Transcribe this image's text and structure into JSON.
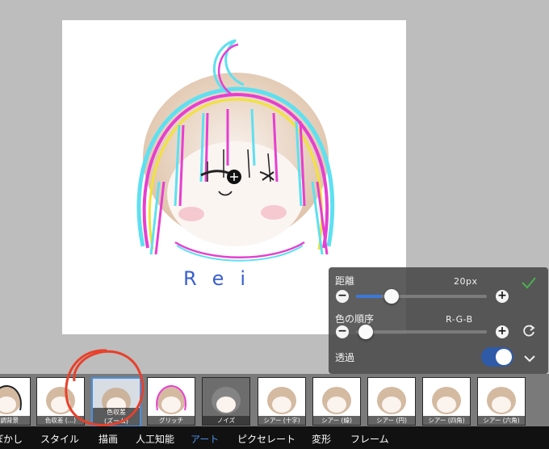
{
  "canvas": {
    "artwork_text": "Rei"
  },
  "panel": {
    "distance_label": "距離",
    "distance_value": "20px",
    "distance_fraction": 0.2,
    "order_label": "色の順序",
    "order_value": "R-G-B",
    "order_fraction": 0.0,
    "transparency_label": "透過",
    "transparency_on": true,
    "icons": {
      "minus": "minus-icon",
      "plus": "plus-icon",
      "apply": "check-icon",
      "reset": "reset-icon",
      "collapse": "chevron-down-icon"
    },
    "minus_glyph": "−",
    "plus_glyph": "+"
  },
  "filters": [
    {
      "label": "ガ調背景"
    },
    {
      "label": "色収差 (…)"
    },
    {
      "label": "色収差\n(ズーム)",
      "selected": true
    },
    {
      "label": "グリッチ"
    },
    {
      "label": "ノイズ"
    },
    {
      "label": "シアー (十字)"
    },
    {
      "label": "シアー (線)"
    },
    {
      "label": "シアー (円)"
    },
    {
      "label": "シアー (四角)"
    },
    {
      "label": "シアー (六角)"
    }
  ],
  "tabs": [
    {
      "label": "ぼかし"
    },
    {
      "label": "スタイル"
    },
    {
      "label": "描画"
    },
    {
      "label": "人工知能"
    },
    {
      "label": "アート",
      "active": true
    },
    {
      "label": "ピクセレート"
    },
    {
      "label": "変形"
    },
    {
      "label": "フレーム"
    }
  ],
  "colors": {
    "accent": "#4a90e2",
    "toggle_on": "#2e5aa8",
    "annotation": "#e8412b",
    "apply_check": "#4caf50"
  }
}
